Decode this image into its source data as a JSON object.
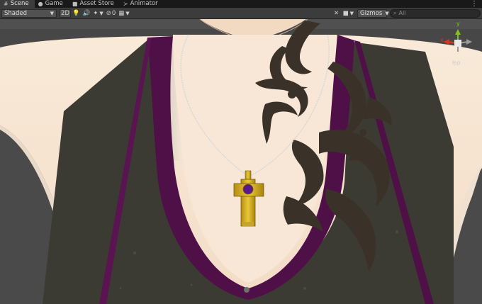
{
  "tabs": [
    {
      "label": "Scene",
      "icon": "scene-grid-icon",
      "active": true
    },
    {
      "label": "Game",
      "icon": "gamepad-icon",
      "active": false
    },
    {
      "label": "Asset Store",
      "icon": "shopping-bag-icon",
      "active": false
    },
    {
      "label": "Animator",
      "icon": "animator-icon",
      "active": false
    }
  ],
  "toolbar": {
    "draw_mode": "Shaded",
    "mode_2d": "2D",
    "hidden_count": "0",
    "gizmos_label": "Gizmos",
    "search_placeholder": "All"
  },
  "gizmo": {
    "axis_x": "x",
    "axis_y": "y",
    "projection": "Iso",
    "colors": {
      "x": "#e0331f",
      "y": "#7fc41f",
      "z": "#3a6fd8"
    }
  },
  "scene_colors": {
    "skin": "#f6e4d2",
    "tank_trim": "#4e1046",
    "tank_fabric": "#3c3b33",
    "tattoo": "#3a3229",
    "cross_gold": "#d9b528",
    "gem": "#5a1a88"
  }
}
